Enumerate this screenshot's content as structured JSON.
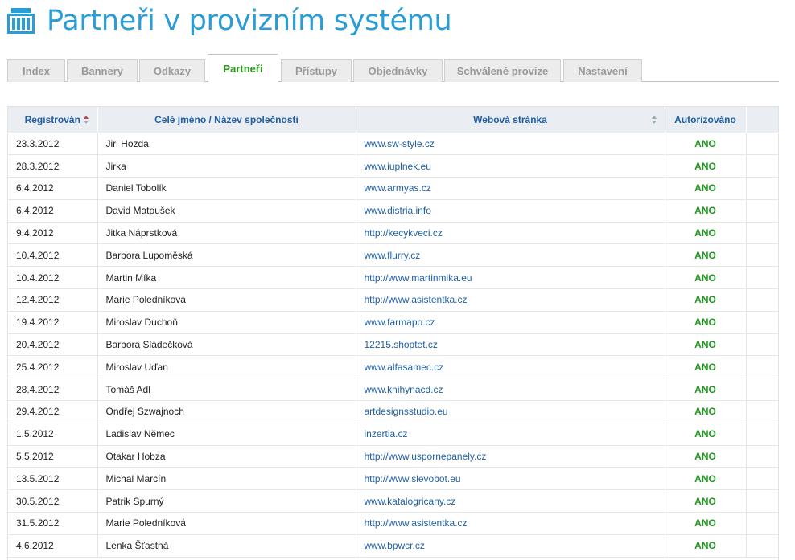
{
  "header": {
    "title": "Partneři v provizním systému",
    "logo_icon": "partner-logo-icon",
    "title_color": "#2a9dd6"
  },
  "tabs": [
    {
      "label": "Index",
      "active": false
    },
    {
      "label": "Bannery",
      "active": false
    },
    {
      "label": "Odkazy",
      "active": false
    },
    {
      "label": "Partneři",
      "active": true
    },
    {
      "label": "Přístupy",
      "active": false
    },
    {
      "label": "Objednávky",
      "active": false
    },
    {
      "label": "Schválené provize",
      "active": false
    },
    {
      "label": "Nastavení",
      "active": false
    }
  ],
  "table": {
    "columns": [
      "Registrován",
      "Celé jméno / Název společnosti",
      "Webová stránka",
      "Autorizováno"
    ],
    "sort_icons": {
      "registered": "sort-desc-icon",
      "website": "sort-neutral-icon"
    },
    "rows": [
      {
        "date": "23.3.2012",
        "name": "Jiri Hozda",
        "web": "www.sw-style.cz",
        "auth": "ANO"
      },
      {
        "date": "28.3.2012",
        "name": "Jirka",
        "web": "www.iuplnek.eu",
        "auth": "ANO"
      },
      {
        "date": "6.4.2012",
        "name": "Daniel Tobolík",
        "web": "www.armyas.cz",
        "auth": "ANO"
      },
      {
        "date": "6.4.2012",
        "name": "David Matoušek",
        "web": "www.distria.info",
        "auth": "ANO"
      },
      {
        "date": "9.4.2012",
        "name": "Jitka Náprstková",
        "web": "http://kecykveci.cz",
        "auth": "ANO"
      },
      {
        "date": "10.4.2012",
        "name": "Barbora Lupoměská",
        "web": "www.flurry.cz",
        "auth": "ANO"
      },
      {
        "date": "10.4.2012",
        "name": "Martin Míka",
        "web": "http://www.martinmika.eu",
        "auth": "ANO"
      },
      {
        "date": "12.4.2012",
        "name": "Marie Poledníková",
        "web": "http://www.asistentka.cz",
        "auth": "ANO"
      },
      {
        "date": "19.4.2012",
        "name": "Miroslav Duchoň",
        "web": "www.farmapo.cz",
        "auth": "ANO"
      },
      {
        "date": "20.4.2012",
        "name": "Barbora Sládečková",
        "web": "12215.shoptet.cz",
        "auth": "ANO"
      },
      {
        "date": "25.4.2012",
        "name": "Miroslav Uďan",
        "web": "www.alfasamec.cz",
        "auth": "ANO"
      },
      {
        "date": "28.4.2012",
        "name": "Tomáš Adl",
        "web": "www.knihynacd.cz",
        "auth": "ANO"
      },
      {
        "date": "29.4.2012",
        "name": "Ondřej Szwajnoch",
        "web": "artdesignsstudio.eu",
        "auth": "ANO"
      },
      {
        "date": "1.5.2012",
        "name": "Ladislav Němec",
        "web": "inzertia.cz",
        "auth": "ANO"
      },
      {
        "date": "5.5.2012",
        "name": "Otakar Hobza",
        "web": "http://www.uspornepanely.cz",
        "auth": "ANO"
      },
      {
        "date": "13.5.2012",
        "name": "Michal Marcín",
        "web": "http://www.slevobot.eu",
        "auth": "ANO"
      },
      {
        "date": "30.5.2012",
        "name": "Patrik Spurný",
        "web": "www.katalogricany.cz",
        "auth": "ANO"
      },
      {
        "date": "31.5.2012",
        "name": "Marie Poledníková",
        "web": "http://www.asistentka.cz",
        "auth": "ANO"
      },
      {
        "date": "4.6.2012",
        "name": "Lenka Šťastná",
        "web": "www.bpwcr.cz",
        "auth": "ANO"
      }
    ]
  }
}
